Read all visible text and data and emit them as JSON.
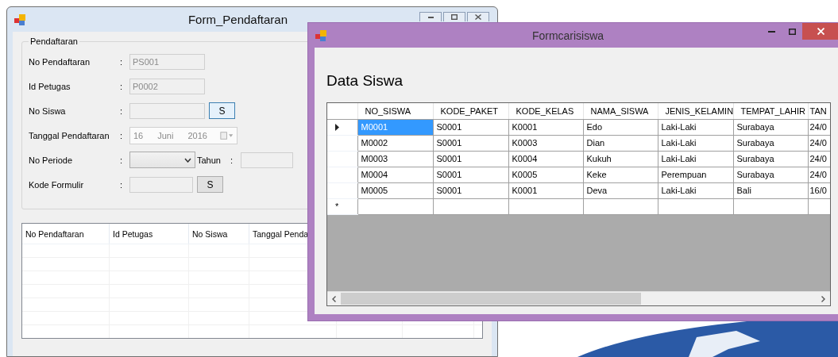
{
  "form_pendaftaran": {
    "title": "Form_Pendaftaran",
    "group_title": "Pendaftaran",
    "fields": [
      {
        "kind": "text",
        "label": "No Pendaftaran",
        "separator": ":",
        "value": "PS001",
        "disabled": true
      },
      {
        "kind": "text",
        "label": "Id Petugas",
        "separator": ":",
        "value": "P0002",
        "disabled": true
      },
      {
        "kind": "text-button",
        "label": "No Siswa",
        "separator": ":",
        "disabled": true,
        "button": "S",
        "button_focused": true
      },
      {
        "kind": "date",
        "label": "Tanggal Pendaftaran",
        "separator": ":",
        "day": "16",
        "month": "Juni",
        "year": "2016",
        "disabled": true
      },
      {
        "kind": "combo-text",
        "label": "No Periode",
        "separator": ":",
        "extra_label": "Tahun",
        "extra_separator": ":",
        "disabled": true
      },
      {
        "kind": "text-button",
        "label": "Kode Formulir",
        "separator": ":",
        "disabled": true,
        "button": "S",
        "button_focused": false
      }
    ],
    "list_columns": [
      "No Pendaftaran",
      "Id Petugas",
      "No Siswa",
      "Tanggal Penda"
    ]
  },
  "formcarisiswa": {
    "title": "Formcarisiswa",
    "heading": "Data Siswa",
    "grid": {
      "columns": [
        "NO_SISWA",
        "KODE_PAKET",
        "KODE_KELAS",
        "NAMA_SISWA",
        "JENIS_KELAMIN",
        "TEMPAT_LAHIR",
        "TAN"
      ],
      "rows": [
        {
          "current": true,
          "cells": [
            {
              "text": "M0001",
              "selected": true
            },
            {
              "text": "S0001",
              "selected": false
            },
            {
              "text": "K0001",
              "selected": false
            },
            {
              "text": "Edo",
              "selected": false
            },
            {
              "text": "Laki-Laki",
              "selected": false
            },
            {
              "text": "Surabaya",
              "selected": false
            },
            {
              "text": "24/0",
              "selected": false
            }
          ]
        },
        {
          "current": false,
          "cells": [
            {
              "text": "M0002",
              "selected": false
            },
            {
              "text": "S0001",
              "selected": false
            },
            {
              "text": "K0003",
              "selected": false
            },
            {
              "text": "Dian",
              "selected": false
            },
            {
              "text": "Laki-Laki",
              "selected": false
            },
            {
              "text": "Surabaya",
              "selected": false
            },
            {
              "text": "24/0",
              "selected": false
            }
          ]
        },
        {
          "current": false,
          "cells": [
            {
              "text": "M0003",
              "selected": false
            },
            {
              "text": "S0001",
              "selected": false
            },
            {
              "text": "K0004",
              "selected": false
            },
            {
              "text": "Kukuh",
              "selected": false
            },
            {
              "text": "Laki-Laki",
              "selected": false
            },
            {
              "text": "Surabaya",
              "selected": false
            },
            {
              "text": "24/0",
              "selected": false
            }
          ]
        },
        {
          "current": false,
          "cells": [
            {
              "text": "M0004",
              "selected": false
            },
            {
              "text": "S0001",
              "selected": false
            },
            {
              "text": "K0005",
              "selected": false
            },
            {
              "text": "Keke",
              "selected": false
            },
            {
              "text": "Perempuan",
              "selected": false
            },
            {
              "text": "Surabaya",
              "selected": false
            },
            {
              "text": "24/0",
              "selected": false
            }
          ]
        },
        {
          "current": false,
          "cells": [
            {
              "text": "M0005",
              "selected": false
            },
            {
              "text": "S0001",
              "selected": false
            },
            {
              "text": "K0001",
              "selected": false
            },
            {
              "text": "Deva",
              "selected": false
            },
            {
              "text": "Laki-Laki",
              "selected": false
            },
            {
              "text": "Bali",
              "selected": false
            },
            {
              "text": "16/0",
              "selected": false
            }
          ]
        }
      ],
      "new_row_marker": "*"
    }
  }
}
